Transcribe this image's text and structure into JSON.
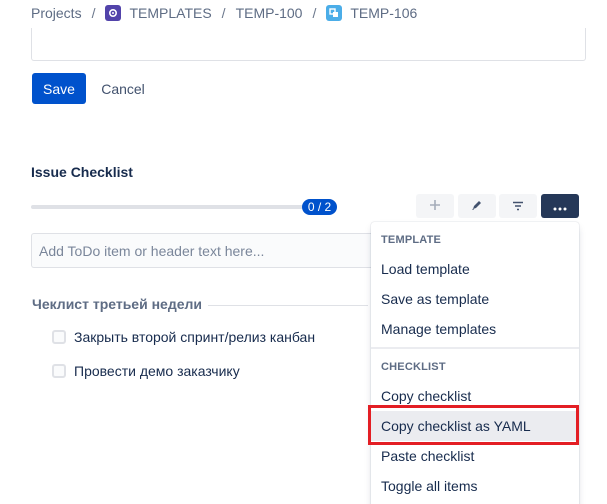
{
  "breadcrumb": {
    "projects": "Projects",
    "separator": "/",
    "templates": "TEMPLATES",
    "parent_issue": "TEMP-100",
    "current_issue": "TEMP-106"
  },
  "editor": {
    "save_label": "Save",
    "cancel_label": "Cancel"
  },
  "checklist": {
    "title": "Issue Checklist",
    "progress_text": "0 / 2",
    "progress_done": 0,
    "progress_total": 2,
    "input_placeholder": "Add ToDo item or header text here...",
    "group_header": "Чеклист третьей недели",
    "items": [
      {
        "label": "Закрыть второй спринт/релиз канбан",
        "checked": false
      },
      {
        "label": "Провести демо заказчику",
        "checked": false
      }
    ]
  },
  "dropdown": {
    "template_heading": "TEMPLATE",
    "template_items": [
      "Load template",
      "Save as template",
      "Manage templates"
    ],
    "checklist_heading": "CHECKLIST",
    "checklist_items": [
      "Copy checklist",
      "Copy checklist as YAML",
      "Paste checklist",
      "Toggle all items"
    ],
    "highlighted_item": "Copy checklist as YAML"
  },
  "colors": {
    "primary": "#0052cc",
    "more_button": "#253858",
    "highlight_border": "#e31e24",
    "templates_icon": "#5243aa",
    "issue_icon": "#4bade8"
  },
  "icons": {
    "templates_project": "project-icon",
    "issue_type": "task-icon",
    "add": "plus-icon",
    "edit": "pencil-icon",
    "filter": "filter-icon",
    "more": "ellipsis-icon"
  }
}
